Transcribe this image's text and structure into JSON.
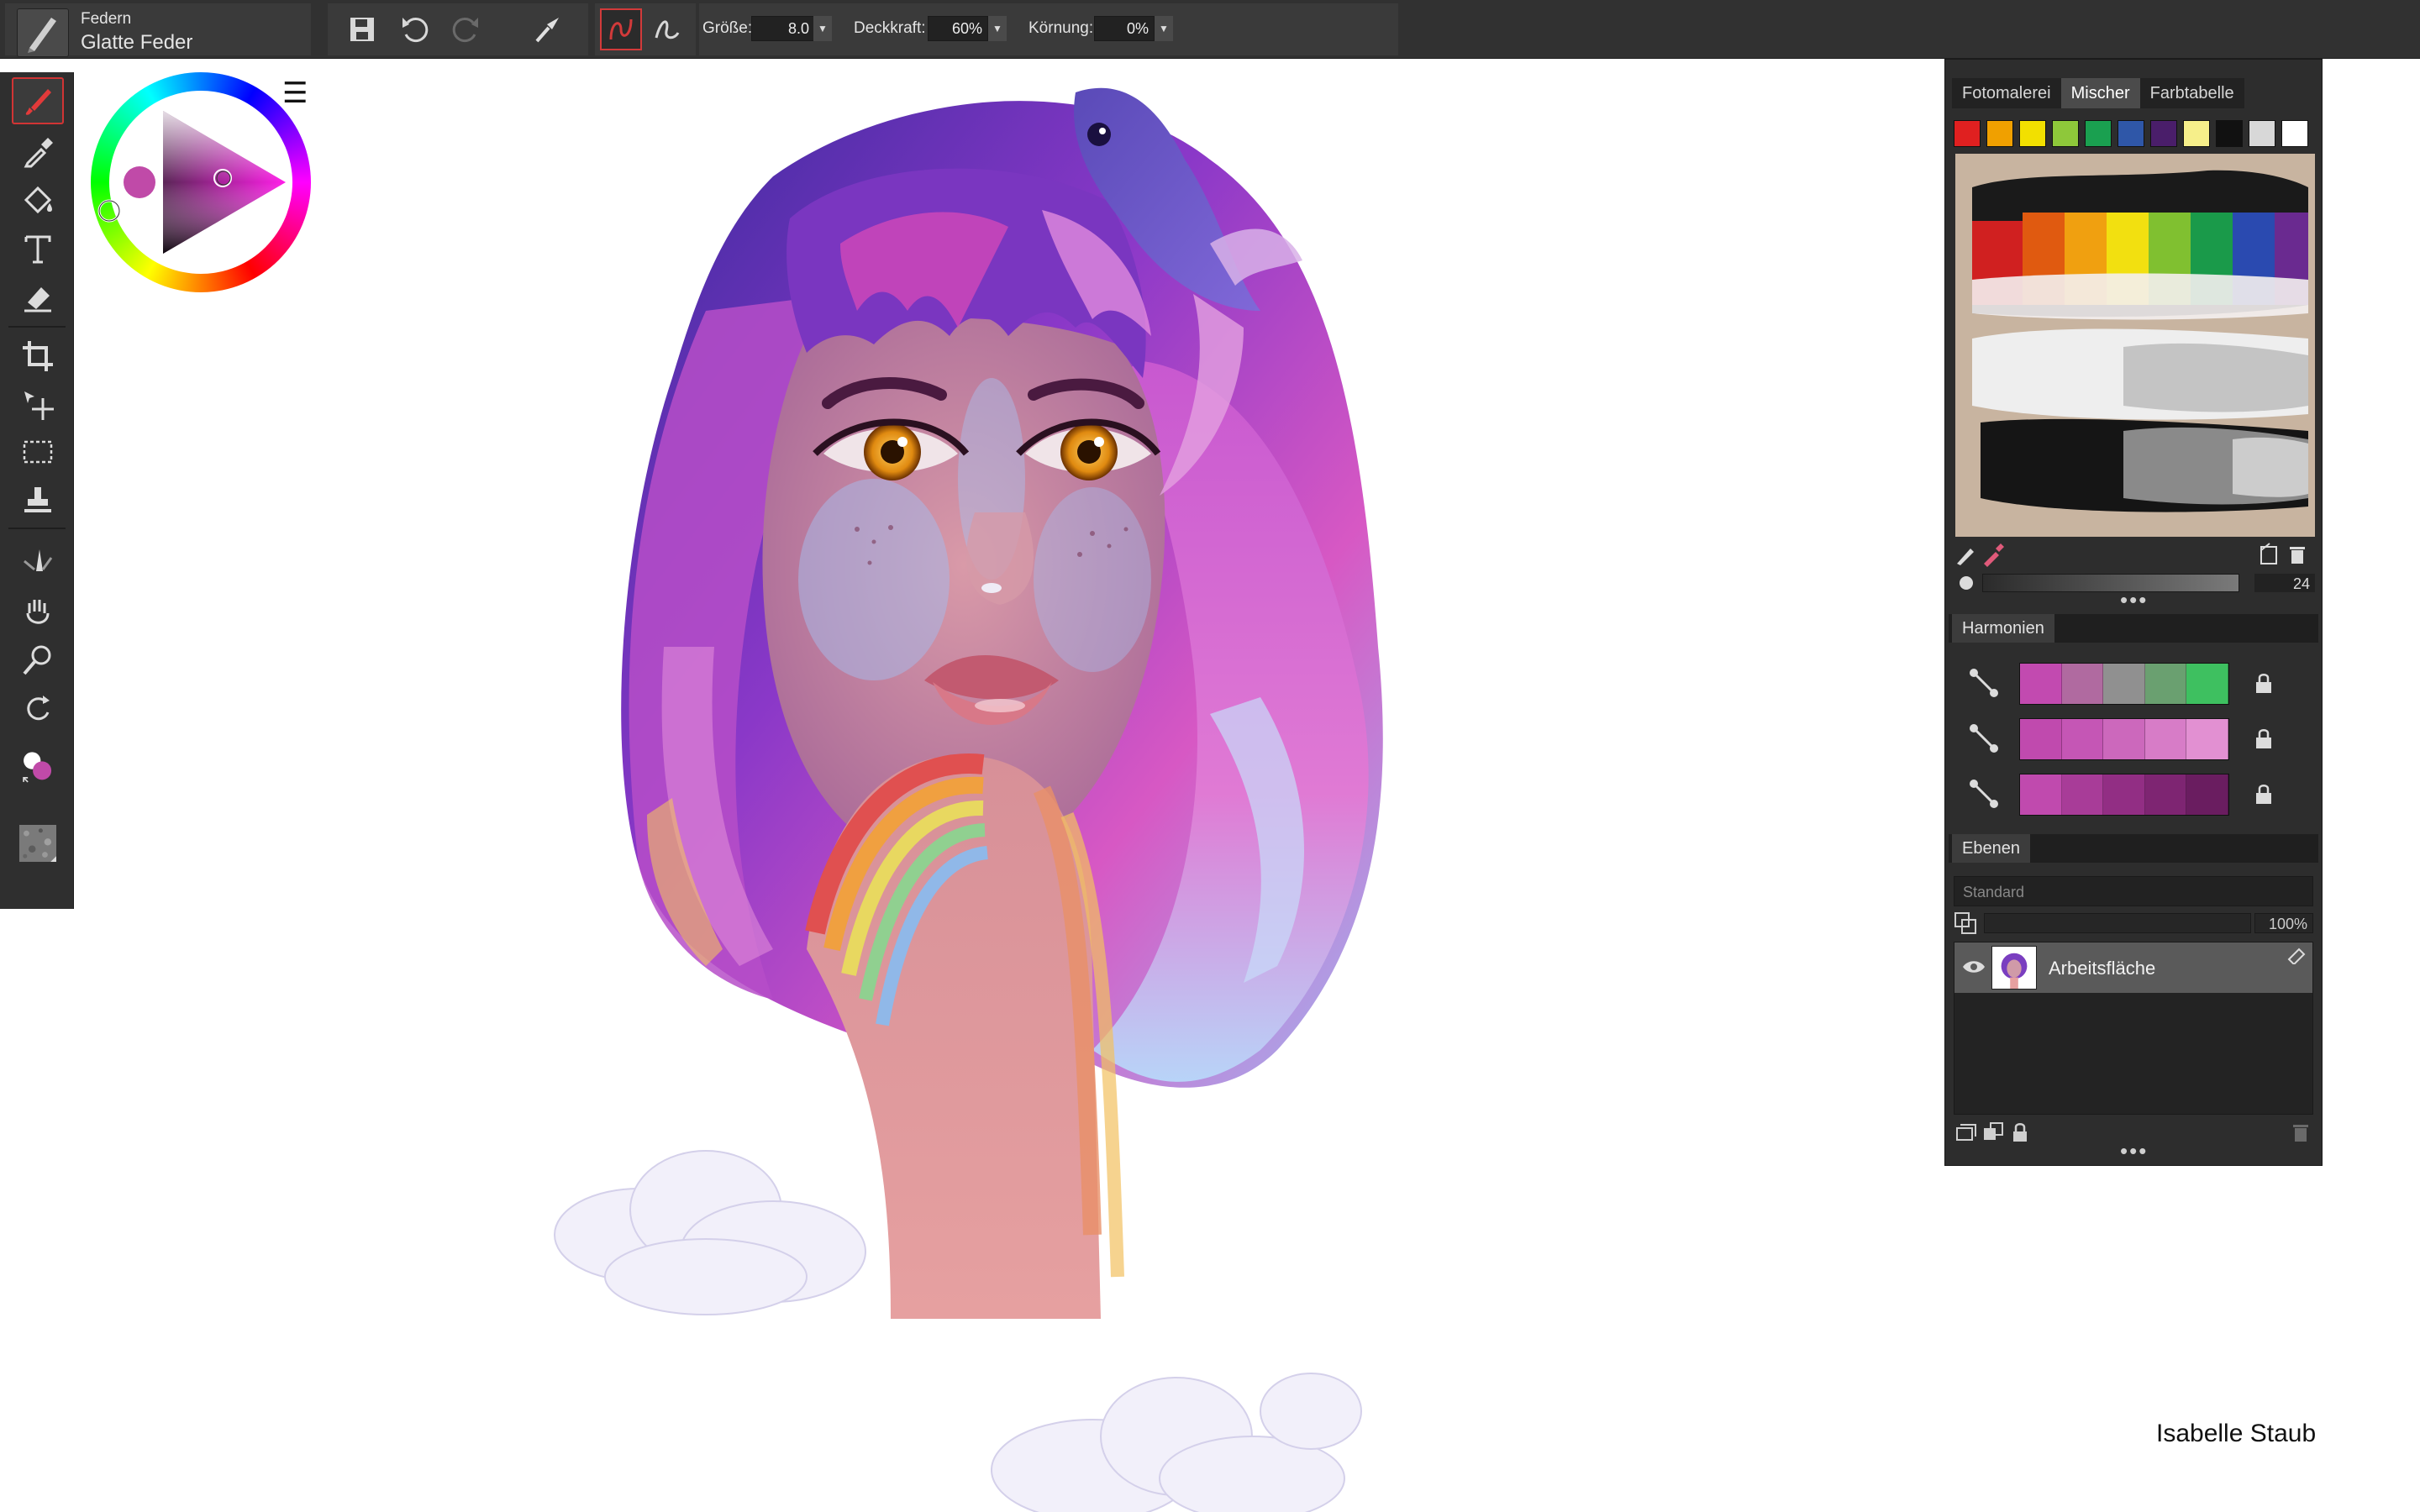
{
  "app": {
    "brush_category": "Federn",
    "brush_name": "Glatte Feder"
  },
  "toolbar": {
    "size_label": "Größe:",
    "size_value": "8.0",
    "opacity_label": "Deckkraft:",
    "opacity_value": "60%",
    "grain_label": "Körnung:",
    "grain_value": "0%",
    "icons": [
      "save-icon",
      "undo-icon",
      "redo-icon",
      "brush-settings-icon",
      "stabilizer-icon",
      "curve-icon"
    ]
  },
  "tools": [
    {
      "name": "brush-tool",
      "icon": "brush-icon",
      "active": true
    },
    {
      "name": "eyedropper-tool",
      "icon": "eyedropper-icon"
    },
    {
      "name": "fill-tool",
      "icon": "paint-bucket-icon"
    },
    {
      "name": "text-tool",
      "icon": "text-icon"
    },
    {
      "name": "eraser-tool",
      "icon": "eraser-icon"
    },
    {
      "name": "crop-tool",
      "icon": "crop-icon"
    },
    {
      "name": "transform-tool",
      "icon": "move-icon"
    },
    {
      "name": "selection-tool",
      "icon": "marquee-icon"
    },
    {
      "name": "stamp-tool",
      "icon": "stamp-icon"
    },
    {
      "name": "blend-tool",
      "icon": "blend-icon"
    },
    {
      "name": "pan-tool",
      "icon": "hand-icon"
    },
    {
      "name": "zoom-tool",
      "icon": "zoom-icon"
    },
    {
      "name": "rotate-tool",
      "icon": "rotate-icon"
    },
    {
      "name": "color-selector",
      "icon": "color-swatch-icon"
    },
    {
      "name": "texture-selector",
      "icon": "texture-icon"
    }
  ],
  "colors": {
    "current": "#c04aa8",
    "secondary": "#ffffff",
    "accent_red": "#d23a3a"
  },
  "right_panel": {
    "tabs": [
      "Fotomalerei",
      "Mischer",
      "Farbtabelle"
    ],
    "active_tab": "Mischer",
    "swatches": [
      "#e02020",
      "#f0a000",
      "#f2e000",
      "#8ec83a",
      "#1aa050",
      "#2f57a8",
      "#4a1e6a",
      "#f6ef8a",
      "#111111",
      "#d8d8d8",
      "#ffffff"
    ],
    "mixer_brush_size": "24",
    "harmonies_title": "Harmonien",
    "harmonies": [
      {
        "icon": "complementary-icon",
        "colors": [
          "#c24ab0",
          "#b06aa0",
          "#909090",
          "#6aa070",
          "#3ec060"
        ]
      },
      {
        "icon": "analogous-icon",
        "colors": [
          "#c04aae",
          "#c556b5",
          "#cc68bc",
          "#d77cc7",
          "#e290d2"
        ]
      },
      {
        "icon": "shades-icon",
        "colors": [
          "#c04aae",
          "#a83c98",
          "#922e84",
          "#7e2572",
          "#6a1d60"
        ]
      }
    ],
    "layers_title": "Ebenen",
    "blend_mode": "Standard",
    "layer_opacity": "100%",
    "layers": [
      {
        "name": "Arbeitsfläche",
        "visible": true
      }
    ]
  },
  "artwork": {
    "credit": "Isabelle Staub"
  }
}
